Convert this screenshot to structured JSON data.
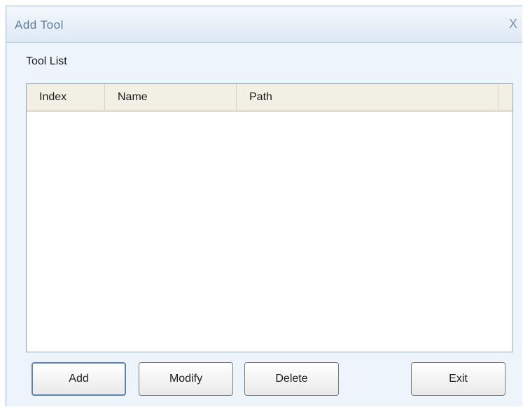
{
  "window": {
    "title": "Add Tool",
    "close_glyph": "X"
  },
  "group": {
    "label": "Tool List"
  },
  "list": {
    "columns": [
      "Index",
      "Name",
      "Path"
    ],
    "rows": []
  },
  "buttons": {
    "add": "Add",
    "modify": "Modify",
    "delete": "Delete",
    "exit": "Exit"
  },
  "colors": {
    "title_text": "#5a7fa8",
    "dialog_bg": "#eef4fb",
    "header_bg": "#f2efe4",
    "default_button_border": "#5b84b5"
  }
}
